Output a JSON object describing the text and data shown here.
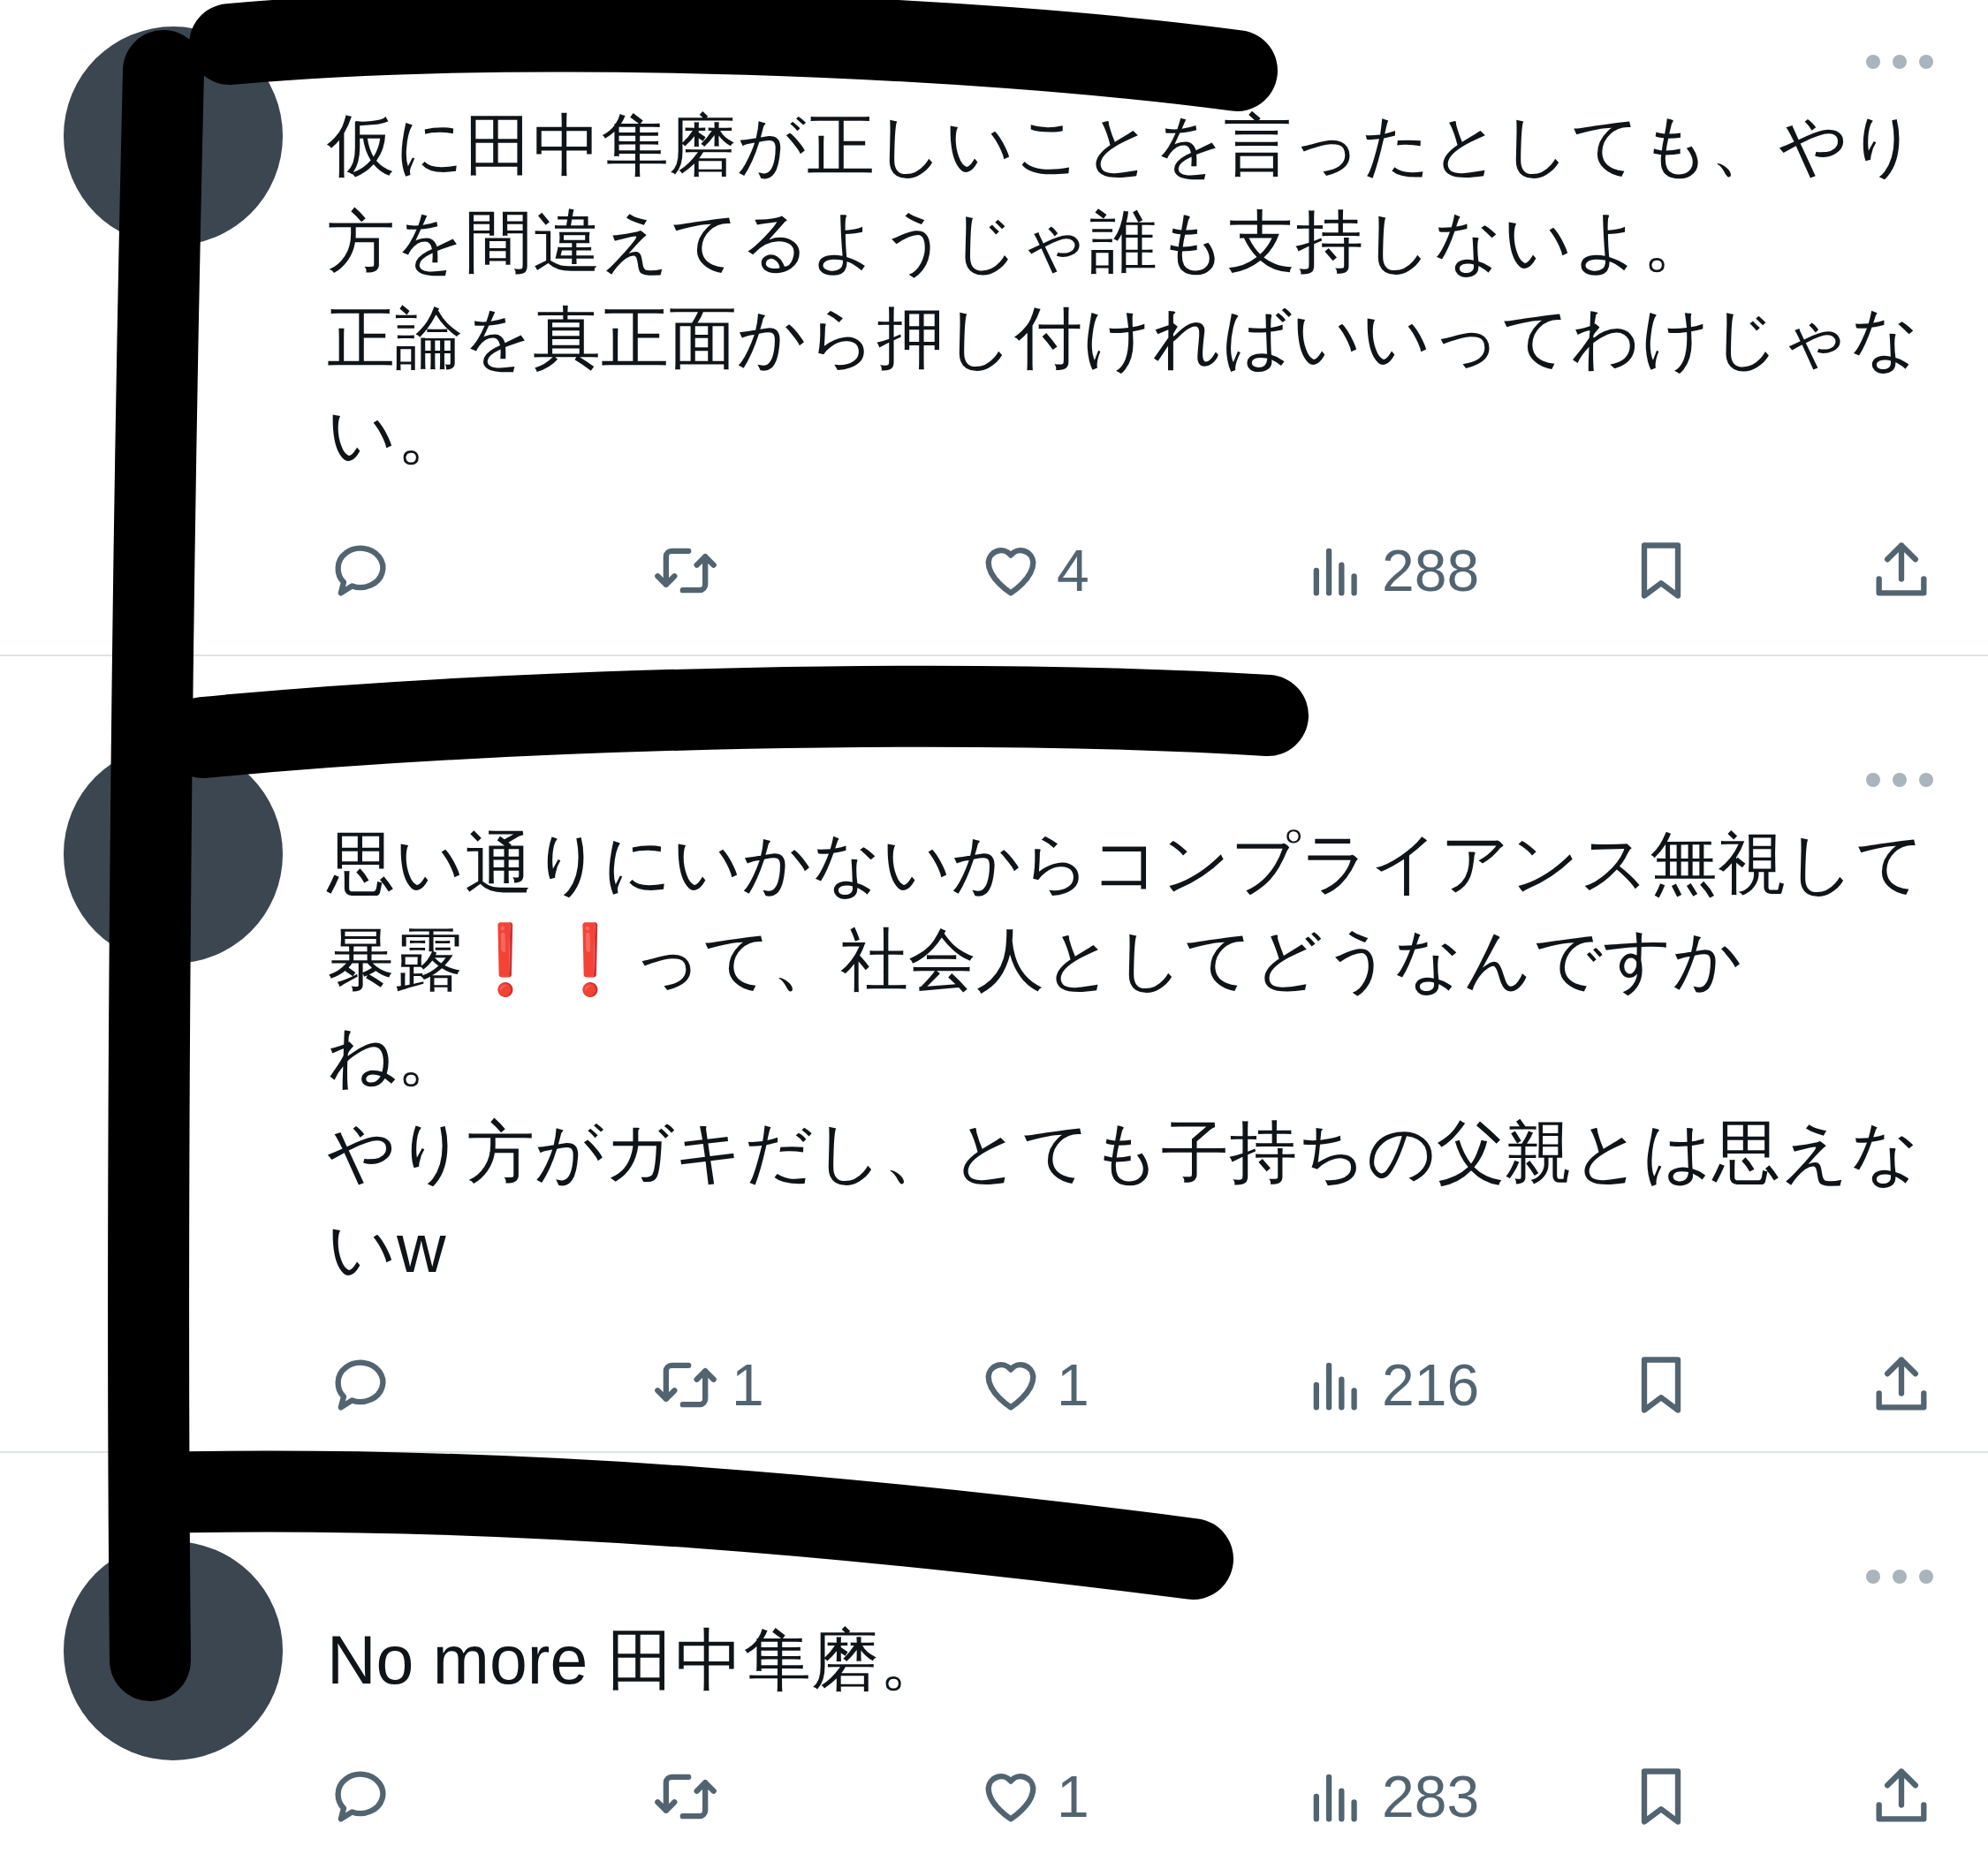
{
  "tweets": [
    {
      "lines": [
        "仮に田中隼磨が正しいことを言ったとしても、やり",
        "方を間違えてるようじゃ誰も支持しないよ。",
        "正論を真正面から押し付ければいいってわけじゃな",
        "い。"
      ],
      "likes": "4",
      "views": "288"
    },
    {
      "lines": [
        "思い通りにいかないからコンプライアンス無視して",
        "暴露❗️❗️って、社会人としてどうなんですか",
        "ね。",
        "やり方がガキだし、とても子持ちの父親とは思えな",
        "いw"
      ],
      "retweets": "1",
      "likes": "1",
      "views": "216"
    },
    {
      "lines": [
        "No more 田中隼磨。"
      ],
      "likes": "1",
      "views": "283"
    }
  ]
}
